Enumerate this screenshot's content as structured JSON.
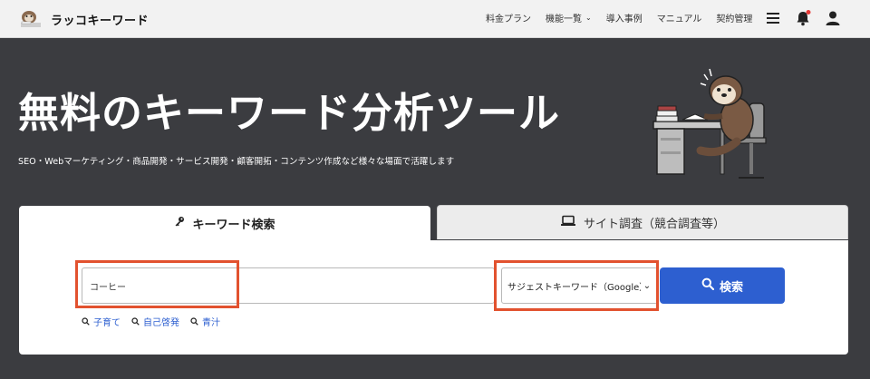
{
  "header": {
    "logo_text": "ラッコキーワード",
    "nav": [
      {
        "label": "料金プラン",
        "dropdown": false
      },
      {
        "label": "機能一覧",
        "dropdown": true
      },
      {
        "label": "導入事例",
        "dropdown": false
      },
      {
        "label": "マニュアル",
        "dropdown": false
      },
      {
        "label": "契約管理",
        "dropdown": false
      }
    ],
    "icons": [
      "hamburger-menu-icon",
      "bell-icon",
      "user-icon"
    ],
    "notification_dot_color": "#e53935"
  },
  "hero": {
    "title": "無料のキーワード分析ツール",
    "subtitle": "SEO・Webマーケティング・商品開発・サービス開発・顧客開拓・コンテンツ作成など様々な場面で活躍します"
  },
  "tabs": [
    {
      "label": "キーワード検索",
      "icon": "key-icon",
      "active": true
    },
    {
      "label": "サイト調査（競合調査等）",
      "icon": "laptop-icon",
      "active": false
    }
  ],
  "search": {
    "value": "コーヒー",
    "mode_selected": "サジェストキーワード（Google）",
    "button_label": "検索",
    "suggestions": [
      "子育て",
      "自己啓発",
      "青汁"
    ]
  },
  "colors": {
    "background": "#3b3c40",
    "accent": "#2d5fd0",
    "highlight": "#e2522f"
  }
}
